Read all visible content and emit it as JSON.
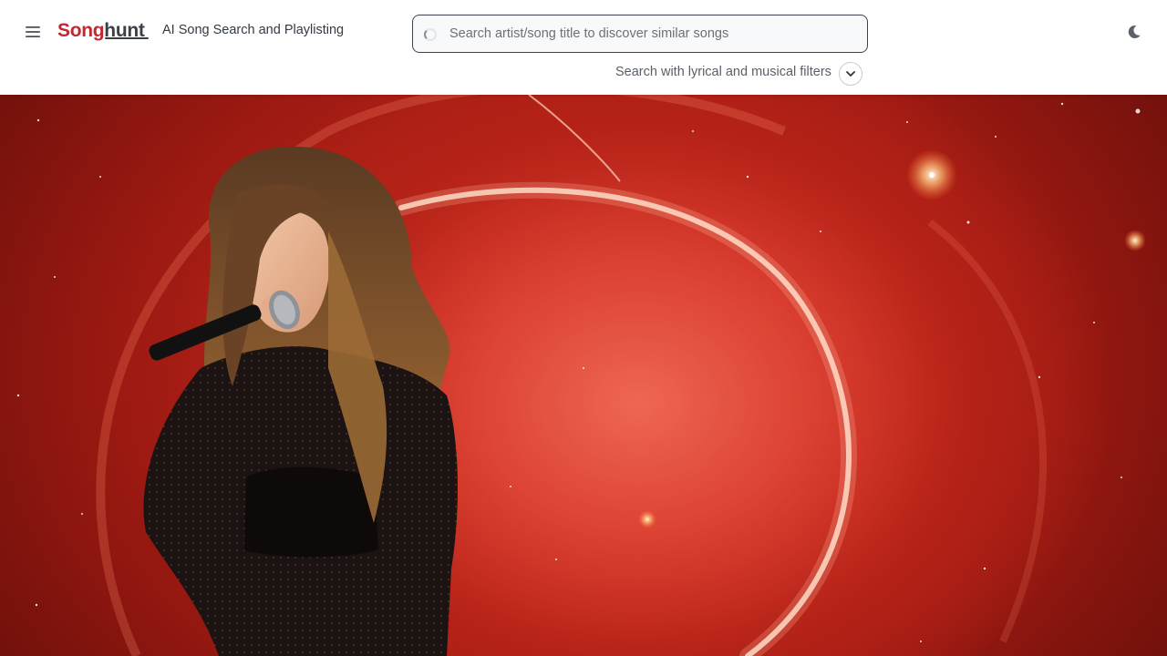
{
  "header": {
    "menu_icon": "hamburger-menu-icon",
    "logo": {
      "part1": "Song",
      "part2": "hunt"
    },
    "tagline": "AI Song Search and Playlisting",
    "search": {
      "placeholder": "Search artist/song title to discover similar songs",
      "value": "",
      "status_icon": "loading-spinner-icon"
    },
    "filters": {
      "label": "Search with lyrical and musical filters",
      "toggle_icon": "chevron-down-icon"
    },
    "theme_icon": "moon-icon"
  },
  "hero": {
    "image": "artist-hero-image",
    "colors": {
      "accent": "#c4272d",
      "background": "#d83a2c"
    }
  }
}
